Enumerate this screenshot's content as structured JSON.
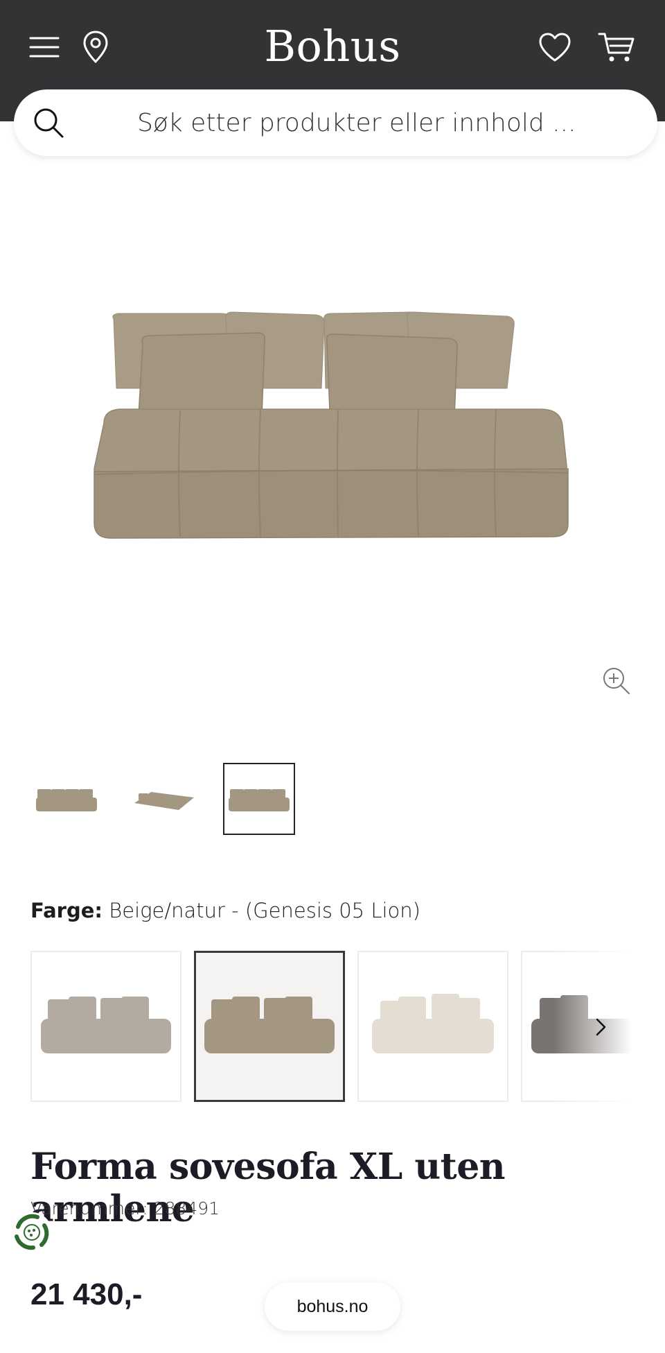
{
  "header": {
    "logo": "Bohus",
    "icons": [
      "menu-icon",
      "location-pin-icon",
      "heart-icon",
      "cart-icon"
    ]
  },
  "search": {
    "placeholder": "Søk etter produkter eller innhold ..."
  },
  "gallery": {
    "thumbnails": [
      "sofa-front-view",
      "sofa-bed-unfolded",
      "sofa-front-view-alt"
    ],
    "active_thumbnail": 3
  },
  "color": {
    "label": "Farge:",
    "value": "Beige/natur - (Genesis 05 Lion)",
    "swatches": [
      "grey-beige",
      "beige-natur",
      "light-cream",
      "dark-grey"
    ],
    "active_swatch": 2
  },
  "product": {
    "title": "Forma sovesofa XL uten armlene",
    "sku": "Varenummer: 288491",
    "price": "21 430,-"
  },
  "footer": {
    "url": "bohus.no"
  },
  "colors": {
    "header_bg": "#333336",
    "gallery_bg": "#f4f2f1",
    "sofa_beige": "#a49782",
    "eco_green": "#2f6a2f"
  }
}
